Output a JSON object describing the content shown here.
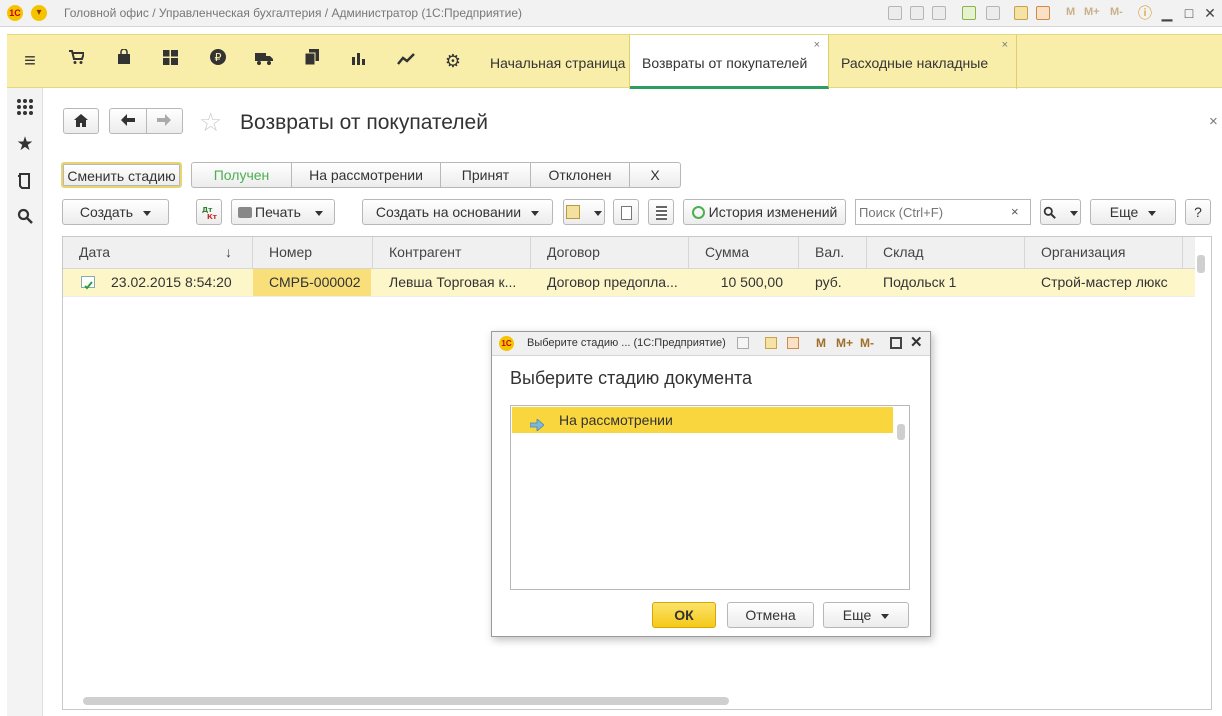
{
  "window": {
    "title": "Головной офис / Управленческая бухгалтерия / Администратор  (1С:Предприятие)",
    "memory_labels": [
      "M",
      "M+",
      "M-"
    ]
  },
  "topbar": {
    "icons": [
      "menu-icon",
      "cart-icon",
      "shopping-bag-icon",
      "grid-icon",
      "ruble-icon",
      "truck-icon",
      "documents-icon",
      "bar-chart-icon",
      "trend-icon",
      "gear-icon"
    ],
    "tabs": [
      {
        "label": "Начальная страница",
        "closable": false,
        "active": false
      },
      {
        "label": "Возвраты от покупателей",
        "closable": true,
        "active": true
      },
      {
        "label": "Расходные накладные",
        "closable": true,
        "active": false
      }
    ],
    "close_glyph": "×"
  },
  "sidebar": {
    "icons": [
      "apps-icon",
      "favorites-star-icon",
      "history-icon",
      "search-icon"
    ]
  },
  "form": {
    "title": "Возвраты от покупателей",
    "change_stage_button": "Сменить стадию",
    "stages": [
      "Получен",
      "На рассмотрении",
      "Принят",
      "Отклонен",
      "X"
    ],
    "stage_colors": {
      "active": "#4caf50"
    },
    "toolbar": {
      "create": "Создать",
      "print": "Печать",
      "create_based_on": "Создать на основании",
      "history": "История изменений",
      "search_placeholder": "Поиск (Ctrl+F)",
      "more": "Еще",
      "help": "?"
    }
  },
  "grid": {
    "columns": [
      "Дата",
      "Номер",
      "Контрагент",
      "Договор",
      "Сумма",
      "Вал.",
      "Склад",
      "Организация"
    ],
    "sort_indicator": "↓",
    "rows": [
      {
        "date": "23.02.2015 8:54:20",
        "number": "СМРБ-000002",
        "counterparty": "Левша Торговая к...",
        "contract": "Договор предопла...",
        "sum": "10 500,00",
        "currency": "руб.",
        "warehouse": "Подольск 1",
        "organization": "Строй-мастер люкс"
      }
    ]
  },
  "dialog": {
    "title": "Выберите стадию ...  (1С:Предприятие)",
    "heading": "Выберите стадию документа",
    "items": [
      "На рассмотрении"
    ],
    "ok": "ОК",
    "cancel": "Отмена",
    "more": "Еще",
    "memory_labels": [
      "M",
      "M+",
      "M-"
    ]
  },
  "colors": {
    "accent_yellow": "#f9d63d",
    "topbar": "#f9eea9",
    "active_tab_underline": "#2e9e60"
  }
}
